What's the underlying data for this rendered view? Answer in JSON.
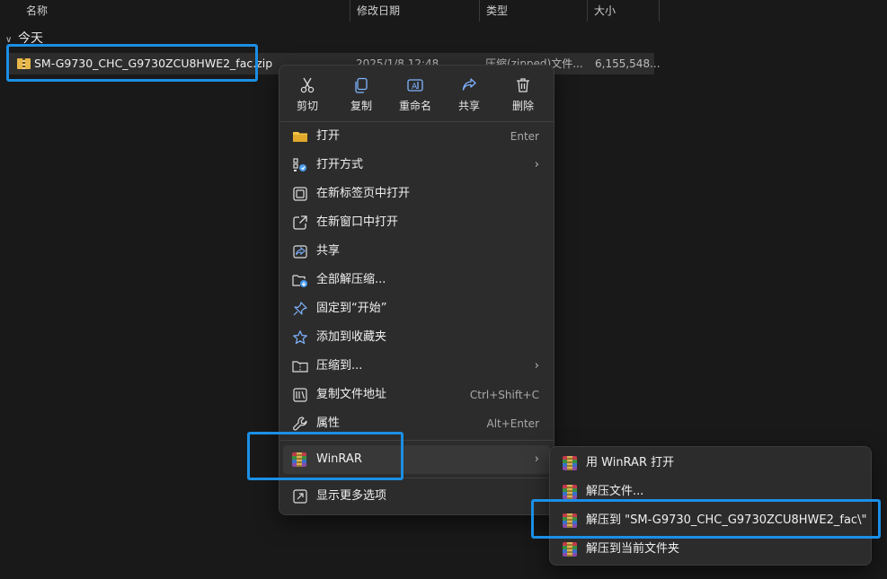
{
  "header": {
    "columns": [
      "名称",
      "修改日期",
      "类型",
      "大小"
    ]
  },
  "group": {
    "label": "今天"
  },
  "file": {
    "name": "SM-G9730_CHC_G9730ZCU8HWE2_fac.zip",
    "date": "2025/1/8 12:48",
    "type": "压缩(zipped)文件...",
    "size": "6,155,548..."
  },
  "context_menu": {
    "quick_actions": [
      {
        "label": "剪切",
        "icon": "scissors-icon"
      },
      {
        "label": "复制",
        "icon": "copy-icon"
      },
      {
        "label": "重命名",
        "icon": "rename-icon"
      },
      {
        "label": "共享",
        "icon": "share-icon"
      },
      {
        "label": "删除",
        "icon": "trash-icon"
      }
    ],
    "items": [
      {
        "label": "打开",
        "shortcut": "Enter",
        "icon": "folder-open-icon"
      },
      {
        "label": "打开方式",
        "icon": "open-with-icon",
        "has_submenu": true
      },
      {
        "label": "在新标签页中打开",
        "icon": "new-tab-icon"
      },
      {
        "label": "在新窗口中打开",
        "icon": "new-window-icon"
      },
      {
        "label": "共享",
        "icon": "share-icon"
      },
      {
        "label": "全部解压缩...",
        "icon": "extract-all-icon"
      },
      {
        "label": "固定到“开始”",
        "icon": "pin-icon"
      },
      {
        "label": "添加到收藏夹",
        "icon": "star-icon"
      },
      {
        "label": "压缩到...",
        "icon": "compress-icon",
        "has_submenu": true
      },
      {
        "label": "复制文件地址",
        "shortcut": "Ctrl+Shift+C",
        "icon": "copy-path-icon"
      },
      {
        "label": "属性",
        "shortcut": "Alt+Enter",
        "icon": "wrench-icon"
      },
      {
        "label": "WinRAR",
        "icon": "winrar-icon",
        "has_submenu": true
      },
      {
        "label": "显示更多选项",
        "icon": "more-options-icon"
      }
    ]
  },
  "winrar_submenu": {
    "items": [
      {
        "label": "用 WinRAR 打开"
      },
      {
        "label": "解压文件..."
      },
      {
        "label": "解压到 \"SM-G9730_CHC_G9730ZCU8HWE2_fac\\\""
      },
      {
        "label": "解压到当前文件夹"
      }
    ]
  },
  "colors": {
    "background": "#191919",
    "menu": "#2c2c2c",
    "highlight": "#1b8fe6",
    "folder_yellow": "#f4c542"
  }
}
